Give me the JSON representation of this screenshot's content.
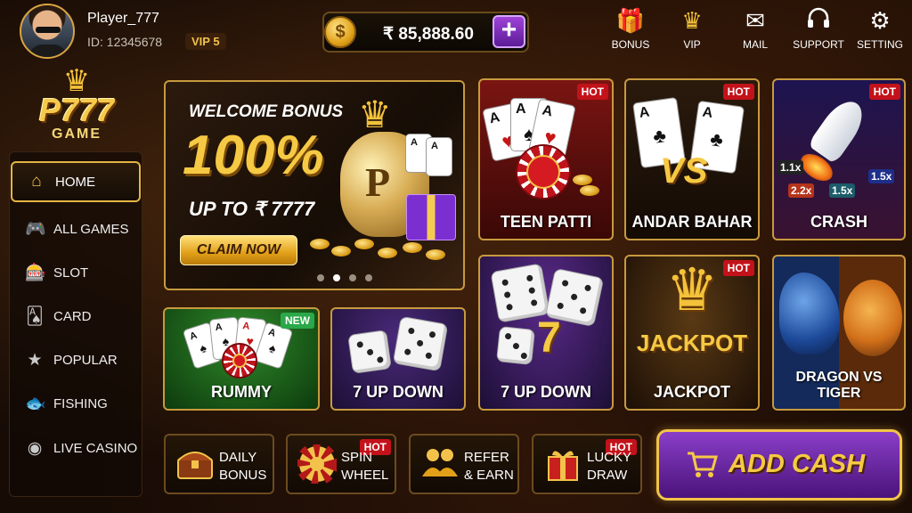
{
  "user": {
    "name": "Player_777",
    "id_text": "ID: 12345678",
    "vip": "VIP 5"
  },
  "wallet": {
    "currency_glyph": "$",
    "balance": "₹ 85,888.60",
    "add_symbol": "+"
  },
  "header_nav": [
    {
      "label": "BONUS",
      "icon": "gift-icon"
    },
    {
      "label": "VIP",
      "icon": "crown-icon"
    },
    {
      "label": "MAIL",
      "icon": "mail-icon"
    },
    {
      "label": "SUPPORT",
      "icon": "headset-icon"
    },
    {
      "label": "SETTING",
      "icon": "gear-icon"
    }
  ],
  "logo": {
    "brand": "P777",
    "sub": "GAME"
  },
  "sidebar": {
    "items": [
      {
        "label": "HOME",
        "icon": "home-icon",
        "active": true
      },
      {
        "label": "ALL GAMES",
        "icon": "gamepad-icon"
      },
      {
        "label": "SLOT",
        "icon": "slot-machine-icon"
      },
      {
        "label": "CARD",
        "icon": "cards-icon"
      },
      {
        "label": "POPULAR",
        "icon": "star-icon"
      },
      {
        "label": "FISHING",
        "icon": "fish-icon"
      },
      {
        "label": "LIVE CASINO",
        "icon": "casino-chip-icon"
      }
    ]
  },
  "banner": {
    "headline": "WELCOME BONUS",
    "percent": "100%",
    "subline": "UP TO ₹ 7777",
    "cta": "CLAIM NOW",
    "bag_letter": "P",
    "slide_count": 4,
    "active_slide": 1
  },
  "games": [
    {
      "label": "TEEN PATTI",
      "badge": "HOT"
    },
    {
      "label": "ANDAR BAHAR",
      "badge": "HOT"
    },
    {
      "label": "CRASH",
      "badge": "HOT",
      "multipliers": [
        "1.1x",
        "2.2x",
        "1.5x",
        "1.5x"
      ]
    },
    {
      "label": "RUMMY",
      "badge": "NEW"
    },
    {
      "label": "7 UP DOWN"
    },
    {
      "label": "7 UP DOWN",
      "big_number": "7"
    },
    {
      "label": "JACKPOT",
      "badge": "HOT",
      "art_text": "JACKPOT"
    },
    {
      "label": "DRAGON VS TIGER"
    }
  ],
  "andar_art": "VS",
  "bottom_actions": [
    {
      "line1": "DAILY",
      "line2": "BONUS",
      "icon": "treasure-chest-icon"
    },
    {
      "line1": "SPIN",
      "line2": "WHEEL",
      "icon": "spin-wheel-icon",
      "badge": "HOT"
    },
    {
      "line1": "REFER",
      "line2": "& EARN",
      "icon": "people-icon"
    },
    {
      "line1": "LUCKY",
      "line2": "DRAW",
      "icon": "gift-box-icon",
      "badge": "HOT"
    }
  ],
  "add_cash": {
    "label": "ADD CASH",
    "icon": "cart-icon"
  },
  "colors": {
    "gold": "#f6c944",
    "purple": "#6a25a8",
    "hot": "#c3121a",
    "new": "#2aa84a"
  }
}
